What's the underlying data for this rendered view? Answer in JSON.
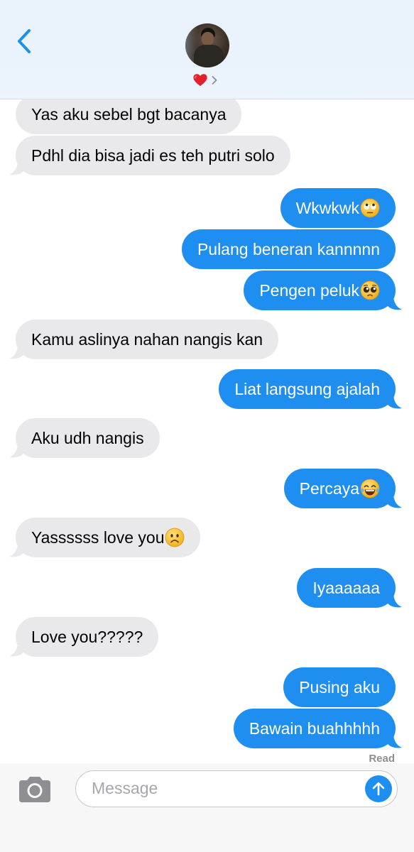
{
  "header": {
    "back_icon": "chevron-left-icon",
    "contact_icon": "heart-icon",
    "details_icon": "chevron-right-icon"
  },
  "messages": [
    {
      "side": "recv",
      "text": "Yas aku sebel bgt bacanya",
      "tail": false
    },
    {
      "side": "recv",
      "text": "Pdhl dia bisa jadi es teh putri solo",
      "tail": true
    },
    {
      "side": "sent",
      "text": "Wkwkwk",
      "emoji": "face-with-rolling-eyes",
      "tail": false
    },
    {
      "side": "sent",
      "text": "Pulang beneran kannnnn",
      "tail": false
    },
    {
      "side": "sent",
      "text": "Pengen peluk",
      "emoji": "pleading-face",
      "tail": true
    },
    {
      "side": "recv",
      "text": "Kamu aslinya nahan nangis kan",
      "tail": true
    },
    {
      "side": "sent",
      "text": "Liat langsung ajalah",
      "tail": true
    },
    {
      "side": "recv",
      "text": "Aku udh nangis",
      "tail": true
    },
    {
      "side": "sent",
      "text": "Percaya",
      "emoji": "face-with-tears-of-joy",
      "tail": true
    },
    {
      "side": "recv",
      "text": "Yassssss love you",
      "emoji": "frowning-face",
      "tail": true
    },
    {
      "side": "sent",
      "text": "Iyaaaaaa",
      "tail": true
    },
    {
      "side": "recv",
      "text": "Love you?????",
      "tail": true
    },
    {
      "side": "sent",
      "text": "Pusing aku",
      "tail": false
    },
    {
      "side": "sent",
      "text": "Bawain buahhhhh",
      "tail": true
    }
  ],
  "read_receipt": "Read",
  "composer": {
    "camera_icon": "camera-icon",
    "placeholder": "Message",
    "value": "",
    "send_icon": "arrow-up-icon"
  },
  "colors": {
    "sent_bubble": "#1f8ef1",
    "received_bubble": "#e9e9eb",
    "header_bg": "#eaf3fb",
    "accent": "#1f8ef1"
  }
}
